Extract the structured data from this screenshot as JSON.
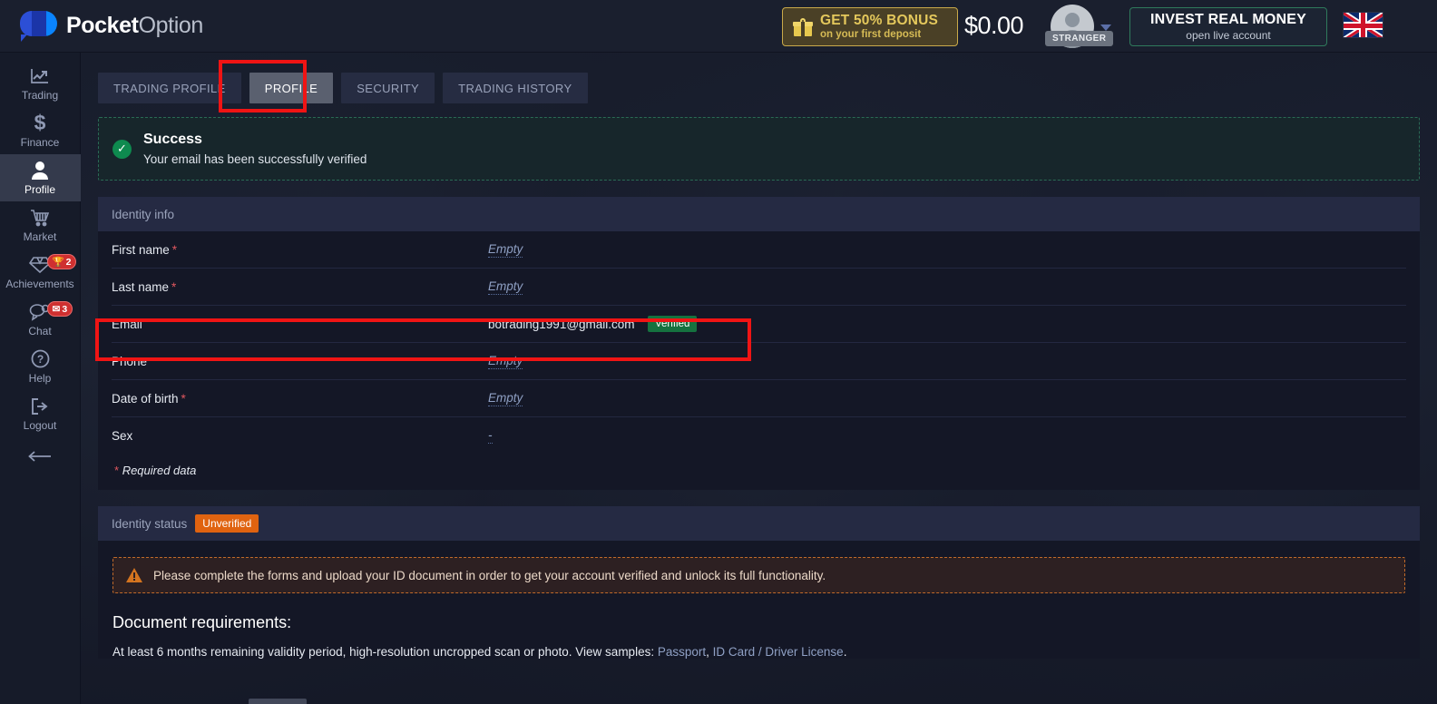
{
  "header": {
    "logo_bold": "Pocket",
    "logo_light": "Option",
    "bonus": {
      "icon": "gift-icon",
      "line1": "GET 50% BONUS",
      "line2": "on your first deposit"
    },
    "balance": "$0.00",
    "avatar_label": "STRANGER",
    "invest": {
      "line1": "INVEST REAL MONEY",
      "line2": "open live account"
    },
    "flag": "uk-flag-icon"
  },
  "sidebar": {
    "items": [
      {
        "label": "Trading",
        "icon": "chart-line-icon",
        "active": false,
        "badge": null
      },
      {
        "label": "Finance",
        "icon": "dollar-icon",
        "active": false,
        "badge": null
      },
      {
        "label": "Profile",
        "icon": "user-icon",
        "active": true,
        "badge": null
      },
      {
        "label": "Market",
        "icon": "cart-icon",
        "active": false,
        "badge": null
      },
      {
        "label": "Achievements",
        "icon": "diamond-icon",
        "active": false,
        "badge": "2",
        "badge_icon": "trophy-icon"
      },
      {
        "label": "Chat",
        "icon": "chat-bubble-icon",
        "active": false,
        "badge": "3",
        "badge_icon": "envelope-icon"
      },
      {
        "label": "Help",
        "icon": "question-icon",
        "active": false,
        "badge": null
      },
      {
        "label": "Logout",
        "icon": "logout-icon",
        "active": false,
        "badge": null
      }
    ],
    "collapse_icon": "arrow-left-icon"
  },
  "tabs": [
    {
      "label": "TRADING PROFILE",
      "active": false
    },
    {
      "label": "PROFILE",
      "active": true
    },
    {
      "label": "SECURITY",
      "active": false
    },
    {
      "label": "TRADING HISTORY",
      "active": false
    }
  ],
  "success_banner": {
    "icon": "check-circle-icon",
    "title": "Success",
    "message": "Your email has been successfully verified"
  },
  "identity_info": {
    "heading": "Identity info",
    "rows": [
      {
        "label": "First name",
        "required": true,
        "value": "Empty",
        "filled": false,
        "badge": null
      },
      {
        "label": "Last name",
        "required": true,
        "value": "Empty",
        "filled": false,
        "badge": null
      },
      {
        "label": "Email",
        "required": false,
        "value": "botrading1991@gmail.com",
        "filled": true,
        "badge": "Verified"
      },
      {
        "label": "Phone",
        "required": false,
        "value": "Empty",
        "filled": false,
        "badge": null
      },
      {
        "label": "Date of birth",
        "required": true,
        "value": "Empty",
        "filled": false,
        "badge": null
      },
      {
        "label": "Sex",
        "required": false,
        "value": "-",
        "filled": false,
        "badge": null
      }
    ],
    "required_note_star": "*",
    "required_note": "Required data"
  },
  "identity_status": {
    "heading": "Identity status",
    "badge": "Unverified",
    "warning_icon": "warning-triangle-icon",
    "warning": "Please complete the forms and upload your ID document in order to get your account verified and unlock its full functionality.",
    "doc_title": "Document requirements:",
    "doc_desc_prefix": "At least 6 months remaining validity period, high-resolution uncropped scan or photo. View samples: ",
    "doc_link_1": "Passport",
    "doc_desc_sep": ", ",
    "doc_link_2": "ID Card / Driver License",
    "doc_desc_suffix": "."
  },
  "annotations": {
    "color": "#f01414",
    "box_tab": "highlight-profile-tab",
    "box_email": "highlight-email-row"
  }
}
